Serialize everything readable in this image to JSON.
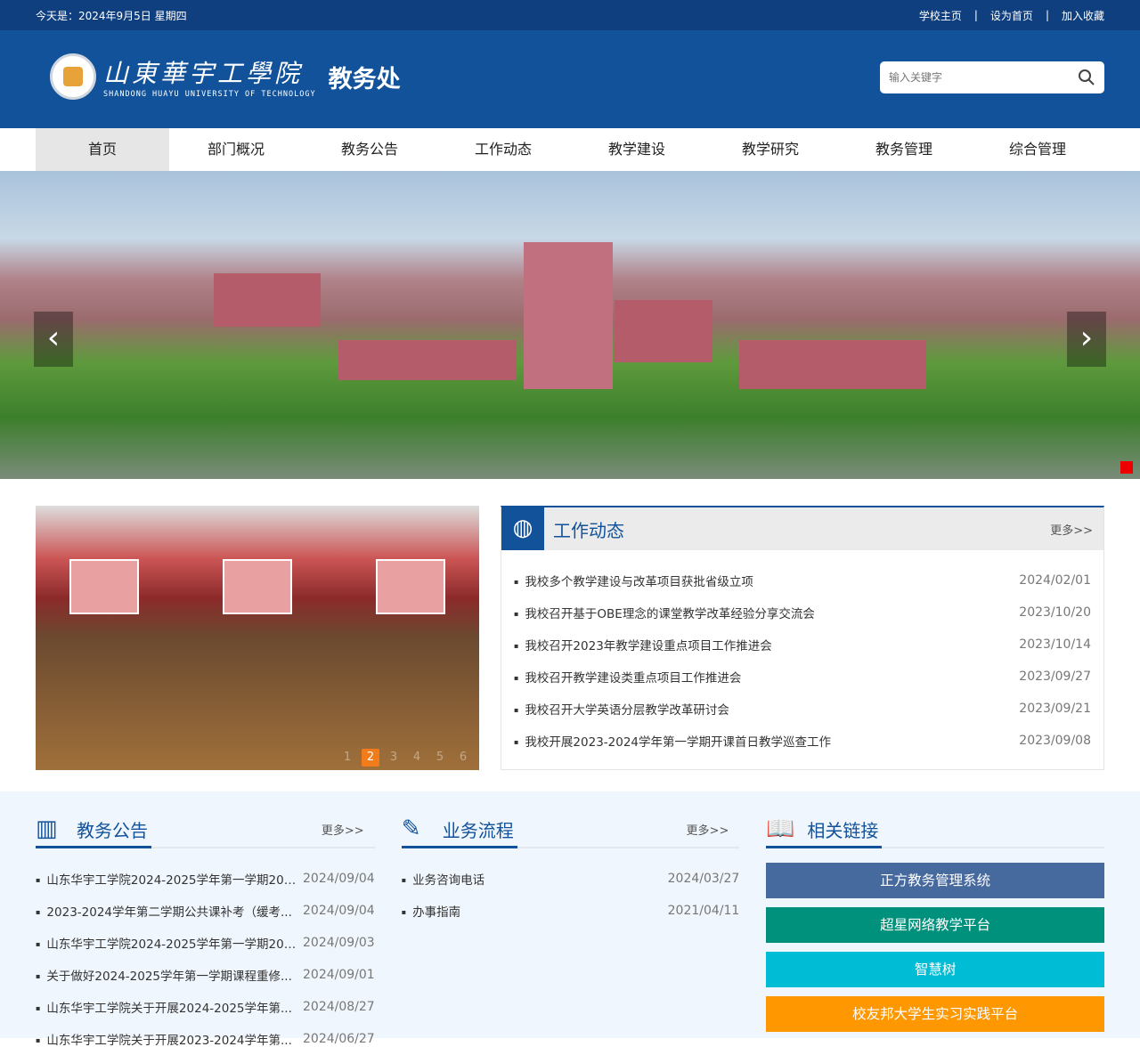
{
  "topbar": {
    "date": "今天是：2024年9月5日  星期四",
    "links": [
      "学校主页",
      "设为首页",
      "加入收藏"
    ],
    "sep": "|"
  },
  "header": {
    "school_cn": "山東華宇工學院",
    "school_en": "SHANDONG HUAYU UNIVERSITY OF TECHNOLOGY",
    "dept": "教务处",
    "search_placeholder": "输入关键字"
  },
  "nav": [
    "首页",
    "部门概况",
    "教务公告",
    "工作动态",
    "教学建设",
    "教学研究",
    "教务管理",
    "综合管理"
  ],
  "banner": {
    "prev": "‹",
    "next": "›"
  },
  "photo": {
    "dots": [
      "1",
      "2",
      "3",
      "4",
      "5",
      "6"
    ],
    "active": 1
  },
  "work": {
    "title": "工作动态",
    "more": "更多>>",
    "items": [
      {
        "t": "我校多个教学建设与改革项目获批省级立项",
        "d": "2024/02/01"
      },
      {
        "t": "我校召开基于OBE理念的课堂教学改革经验分享交流会",
        "d": "2023/10/20"
      },
      {
        "t": "我校召开2023年教学建设重点项目工作推进会",
        "d": "2023/10/14"
      },
      {
        "t": "我校召开教学建设类重点项目工作推进会",
        "d": "2023/09/27"
      },
      {
        "t": "我校召开大学英语分层教学改革研讨会",
        "d": "2023/09/21"
      },
      {
        "t": "我校开展2023-2024学年第一学期开课首日教学巡查工作",
        "d": "2023/09/08"
      }
    ]
  },
  "notice": {
    "title": "教务公告",
    "more": "更多>>",
    "items": [
      {
        "t": "山东华宇工学院2024-2025学年第一学期202...",
        "d": "2024/09/04"
      },
      {
        "t": "2023-2024学年第二学期公共课补考（缓考...",
        "d": "2024/09/04"
      },
      {
        "t": "山东华宇工学院2024-2025学年第一学期202...",
        "d": "2024/09/03"
      },
      {
        "t": "关于做好2024-2025学年第一学期课程重修...",
        "d": "2024/09/01"
      },
      {
        "t": "山东华宇工学院关于开展2024-2025学年第...",
        "d": "2024/08/27"
      },
      {
        "t": "山东华宇工学院关于开展2023-2024学年第...",
        "d": "2024/06/27"
      }
    ]
  },
  "process": {
    "title": "业务流程",
    "more": "更多>>",
    "items": [
      {
        "t": "业务咨询电话",
        "d": "2024/03/27"
      },
      {
        "t": "办事指南",
        "d": "2021/04/11"
      }
    ]
  },
  "links": {
    "title": "相关链接",
    "items": [
      {
        "t": "正方教务管理系统",
        "c": "#476a9e"
      },
      {
        "t": "超星网络教学平台",
        "c": "#00917c"
      },
      {
        "t": "智慧树",
        "c": "#00bcd4"
      },
      {
        "t": "校友邦大学生实习实践平台",
        "c": "#ff9800"
      }
    ]
  }
}
